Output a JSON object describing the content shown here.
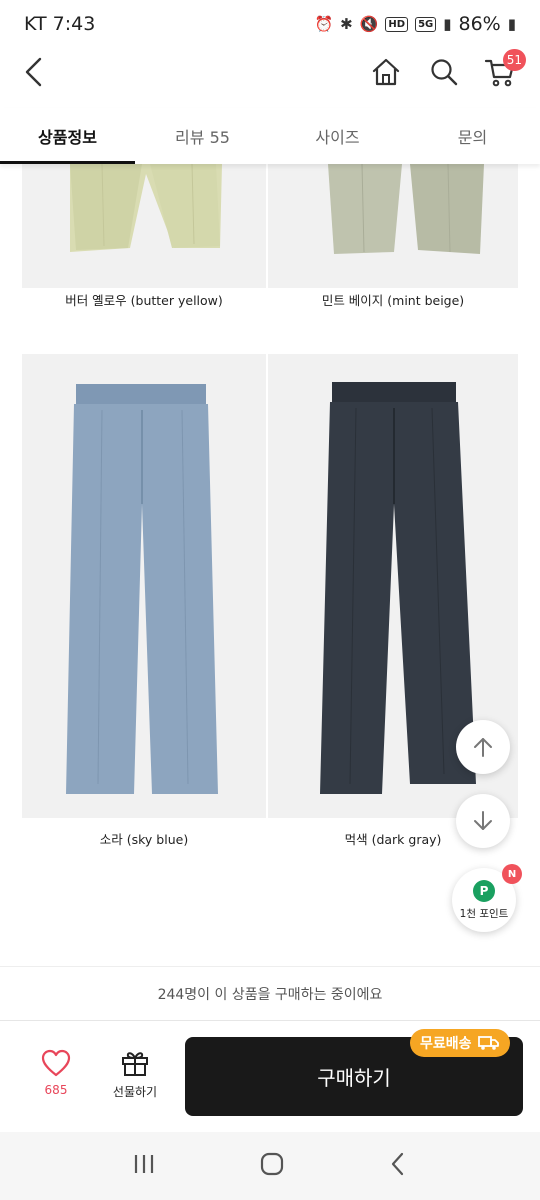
{
  "status": {
    "carrier_time": "KT 7:43",
    "battery": "86%",
    "hd": "HD",
    "net": "5G"
  },
  "header": {
    "cart_count": "51"
  },
  "tabs": [
    {
      "label": "상품정보",
      "active": true
    },
    {
      "label": "리뷰 55",
      "active": false
    },
    {
      "label": "사이즈",
      "active": false
    },
    {
      "label": "문의",
      "active": false
    }
  ],
  "products": [
    {
      "caption": "버터 옐로우 (butter yellow)",
      "color": "#d9dcb2"
    },
    {
      "caption": "민트 베이지 (mint beige)",
      "color": "#bfc3ae"
    },
    {
      "caption": "소라 (sky blue)",
      "color": "#8da5bf"
    },
    {
      "caption": "먹색 (dark gray)",
      "color": "#343b45"
    }
  ],
  "points": {
    "icon_letter": "P",
    "label": "1천 포인트",
    "badge": "N"
  },
  "viewers_text": "244명이 이 상품을 구매하는 중이에요",
  "bottom": {
    "like_count": "685",
    "gift_label": "선물하기",
    "buy_label": "구매하기",
    "shipping_badge": "무료배송"
  },
  "colors": {
    "accent_red": "#f0525b",
    "buy_button": "#191919",
    "shipping_orange": "#f6a623",
    "points_green": "#1aa060"
  }
}
